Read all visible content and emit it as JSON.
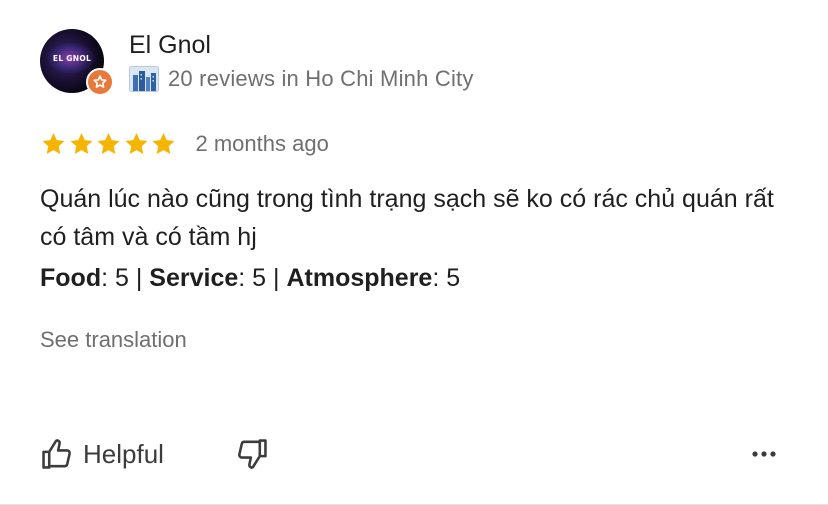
{
  "reviewer": {
    "avatar_text": "EL GNOL",
    "name": "El Gnol",
    "stats": "20 reviews in Ho Chi Minh City",
    "badge_icon": "star-icon",
    "city_icon": "city-buildings-icon"
  },
  "review": {
    "rating": 5,
    "rating_max": 5,
    "star_color": "#f5b400",
    "date": "2 months ago",
    "text": "Quán lúc nào cũng trong tình trạng sạch sẽ ko có rác chủ quán rất có tâm và có tầm hj",
    "sub_ratings": [
      {
        "label": "Food",
        "value": "5"
      },
      {
        "label": "Service",
        "value": "5"
      },
      {
        "label": "Atmosphere",
        "value": "5"
      }
    ],
    "separator": " | ",
    "see_translation": "See translation"
  },
  "actions": {
    "helpful_label": "Helpful",
    "helpful_icon": "thumb-up-icon",
    "not_helpful_icon": "thumb-down-icon",
    "more_icon": "more-horizontal-icon"
  },
  "colors": {
    "text_primary": "#1f1f1f",
    "text_secondary": "#6f6f6f",
    "badge": "#e8793b"
  }
}
